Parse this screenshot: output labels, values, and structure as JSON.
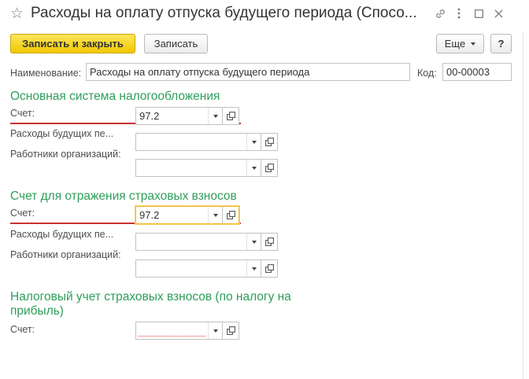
{
  "window": {
    "title": "Расходы на оплату отпуска будущего периода (Спосо..."
  },
  "toolbar": {
    "save_close_label": "Записать и закрыть",
    "save_label": "Записать",
    "more_label": "Еще",
    "help_label": "?"
  },
  "header": {
    "name_label": "Наименование:",
    "name_value": "Расходы на оплату отпуска будущего периода",
    "code_label": "Код:",
    "code_value": "00-00003"
  },
  "section1": {
    "heading": "Основная система налогообложения",
    "account_label": "Счет:",
    "account_value": "97.2",
    "future_expenses_label": "Расходы будущих пе...",
    "future_expenses_value": "",
    "employees_label": "Работники организаций:",
    "employees_value": ""
  },
  "section2": {
    "heading": "Счет для отражения страховых взносов",
    "account_label": "Счет:",
    "account_value": "97.2",
    "future_expenses_label": "Расходы будущих пе...",
    "future_expenses_value": "",
    "employees_label": "Работники организаций:",
    "employees_value": ""
  },
  "section3": {
    "heading_line1": "Налоговый учет страховых взносов (по налогу на",
    "heading_line2": "прибыль)",
    "account_label": "Счет:",
    "account_value": ""
  },
  "colors": {
    "heading_green": "#2e9e59",
    "primary_button": "#f5d32c",
    "underline_red": "#c8342e",
    "focus_border": "#f0b92b"
  }
}
